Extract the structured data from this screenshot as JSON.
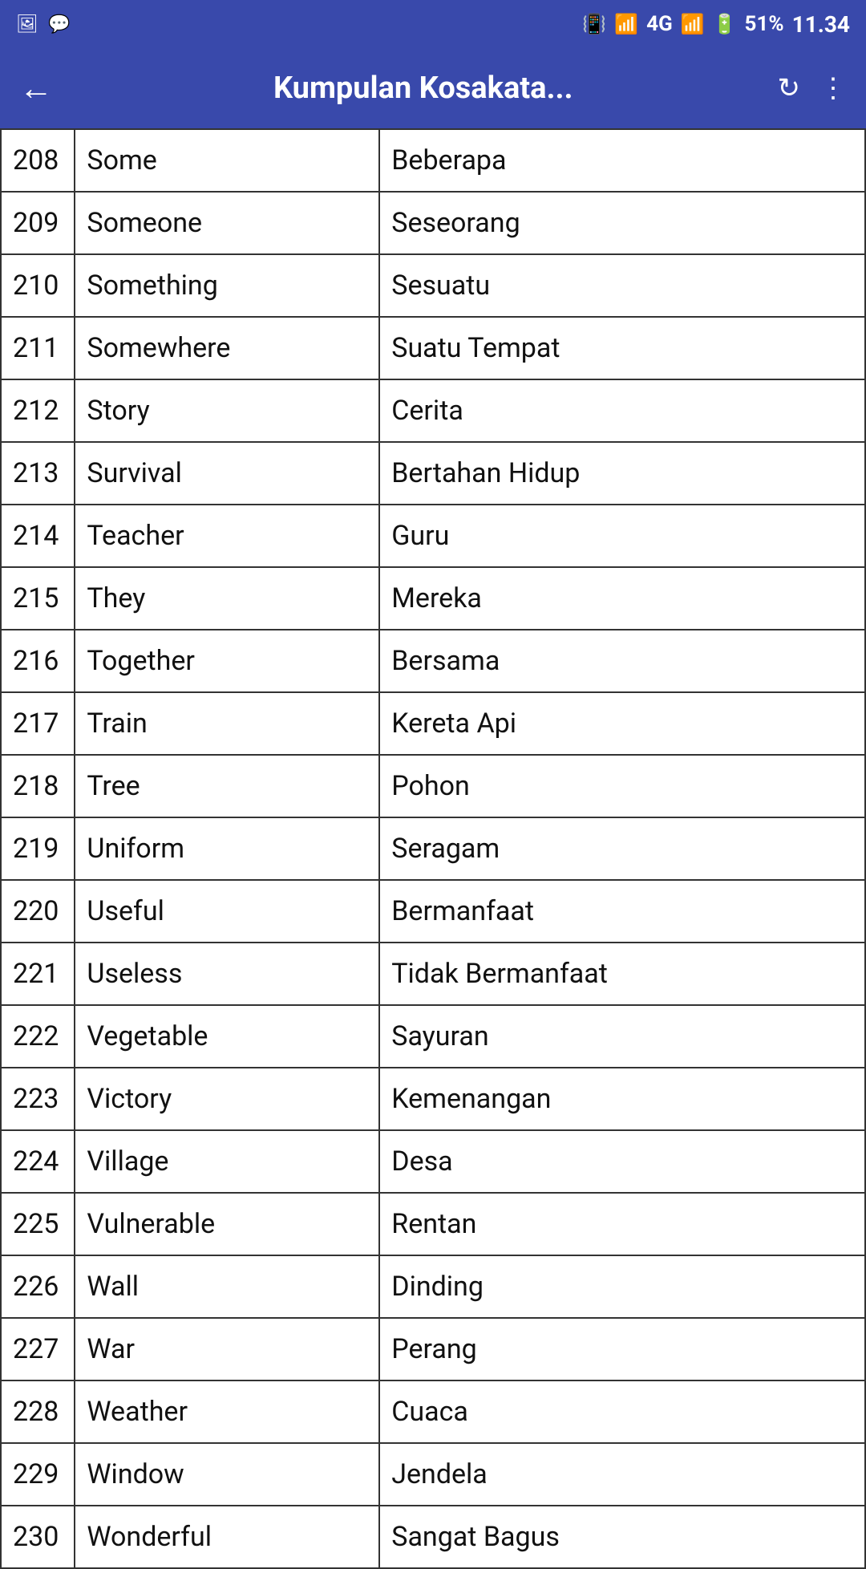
{
  "statusBar": {
    "battery": "51%",
    "time": "11.34",
    "signal": "4G"
  },
  "appBar": {
    "title": "Kumpulan Kosakata...",
    "backLabel": "←",
    "refreshLabel": "↻",
    "moreLabel": "⋮"
  },
  "vocab": [
    {
      "num": "208",
      "en": "Some",
      "id": "Beberapa"
    },
    {
      "num": "209",
      "en": "Someone",
      "id": "Seseorang"
    },
    {
      "num": "210",
      "en": "Something",
      "id": "Sesuatu"
    },
    {
      "num": "211",
      "en": "Somewhere",
      "id": "Suatu Tempat"
    },
    {
      "num": "212",
      "en": "Story",
      "id": "Cerita"
    },
    {
      "num": "213",
      "en": "Survival",
      "id": "Bertahan Hidup"
    },
    {
      "num": "214",
      "en": "Teacher",
      "id": "Guru"
    },
    {
      "num": "215",
      "en": "They",
      "id": "Mereka"
    },
    {
      "num": "216",
      "en": "Together",
      "id": "Bersama"
    },
    {
      "num": "217",
      "en": "Train",
      "id": "Kereta Api"
    },
    {
      "num": "218",
      "en": "Tree",
      "id": "Pohon"
    },
    {
      "num": "219",
      "en": "Uniform",
      "id": "Seragam"
    },
    {
      "num": "220",
      "en": "Useful",
      "id": "Bermanfaat"
    },
    {
      "num": "221",
      "en": "Useless",
      "id": "Tidak Bermanfaat"
    },
    {
      "num": "222",
      "en": "Vegetable",
      "id": "Sayuran"
    },
    {
      "num": "223",
      "en": "Victory",
      "id": "Kemenangan"
    },
    {
      "num": "224",
      "en": "Village",
      "id": "Desa"
    },
    {
      "num": "225",
      "en": "Vulnerable",
      "id": "Rentan"
    },
    {
      "num": "226",
      "en": "Wall",
      "id": "Dinding"
    },
    {
      "num": "227",
      "en": "War",
      "id": "Perang"
    },
    {
      "num": "228",
      "en": "Weather",
      "id": "Cuaca"
    },
    {
      "num": "229",
      "en": "Window",
      "id": "Jendela"
    },
    {
      "num": "230",
      "en": "Wonderful",
      "id": "Sangat Bagus"
    }
  ]
}
